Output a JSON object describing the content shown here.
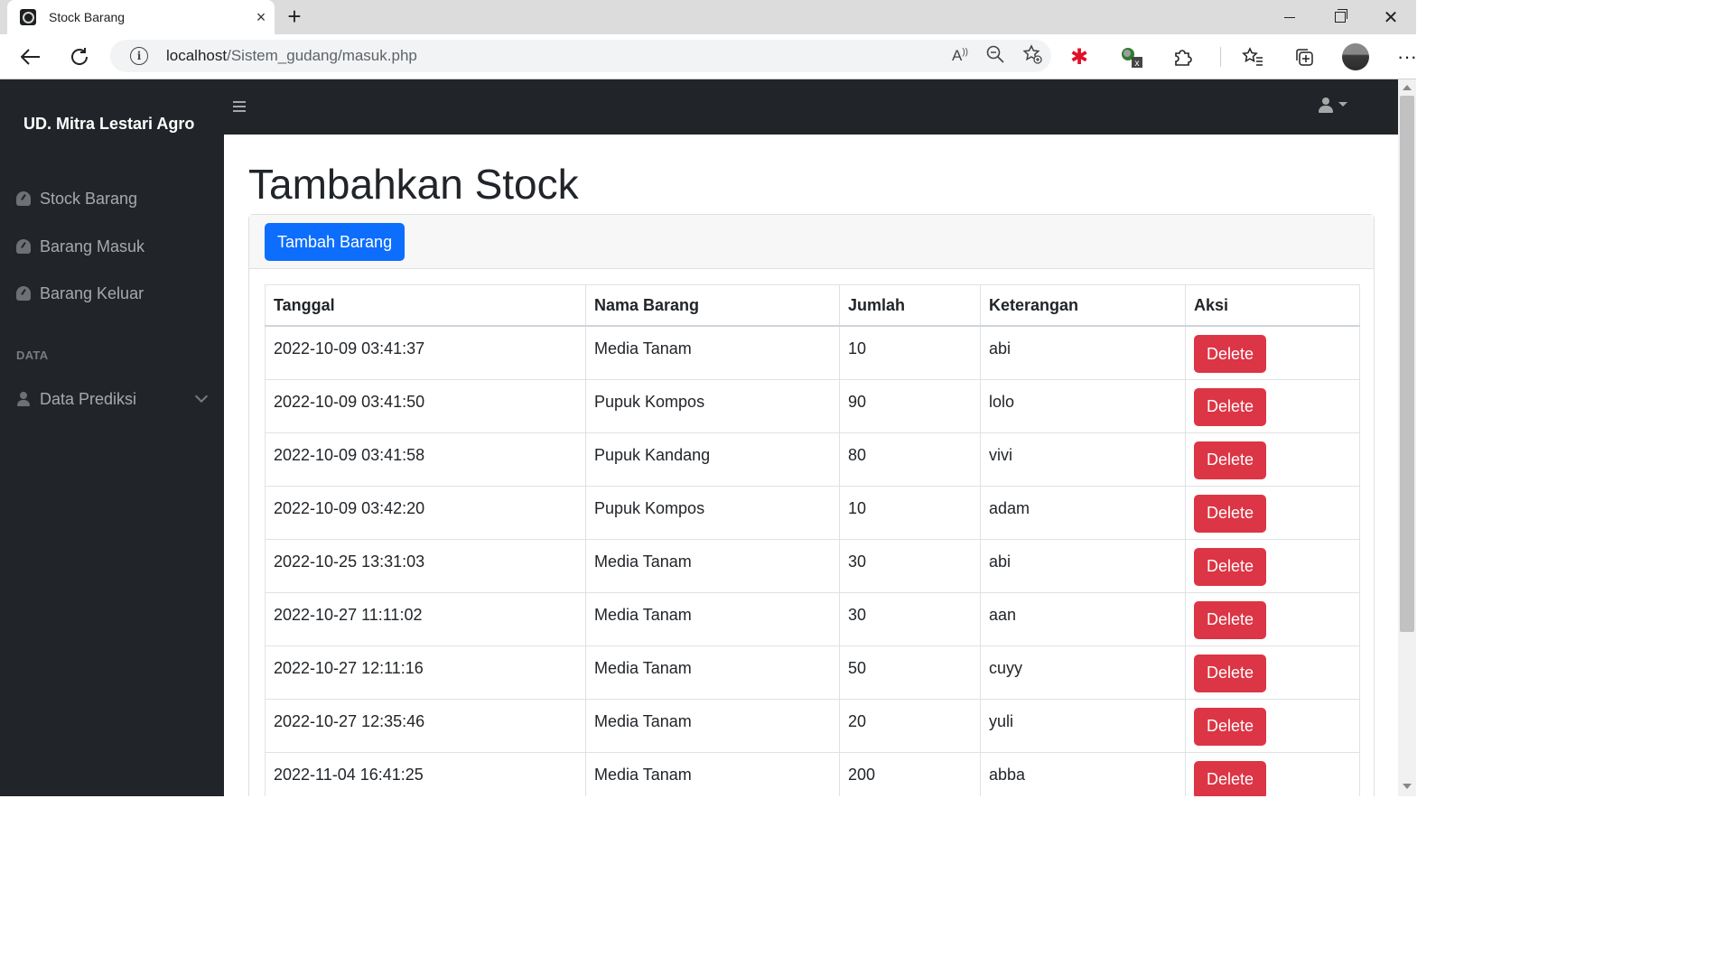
{
  "browser": {
    "tab_title": "Stock Barang",
    "url_host": "localhost",
    "url_path": "/Sistem_gudang/masuk.php"
  },
  "sidebar": {
    "brand": "UD. Mitra Lestari Agro",
    "items": [
      {
        "label": "Stock Barang",
        "icon": "gauge-icon"
      },
      {
        "label": "Barang Masuk",
        "icon": "gauge-icon"
      },
      {
        "label": "Barang Keluar",
        "icon": "gauge-icon"
      }
    ],
    "heading": "DATA",
    "dropdown": {
      "label": "Data Prediksi",
      "icon": "user-icon"
    }
  },
  "main": {
    "title": "Tambahkan Stock",
    "add_button": "Tambah Barang",
    "table": {
      "headers": [
        "Tanggal",
        "Nama Barang",
        "Jumlah",
        "Keterangan",
        "Aksi"
      ],
      "delete_label": "Delete",
      "rows": [
        [
          "2022-10-09 03:41:37",
          "Media Tanam",
          "10",
          "abi"
        ],
        [
          "2022-10-09 03:41:50",
          "Pupuk Kompos",
          "90",
          "lolo"
        ],
        [
          "2022-10-09 03:41:58",
          "Pupuk Kandang",
          "80",
          "vivi"
        ],
        [
          "2022-10-09 03:42:20",
          "Pupuk Kompos",
          "10",
          "adam"
        ],
        [
          "2022-10-25 13:31:03",
          "Media Tanam",
          "30",
          "abi"
        ],
        [
          "2022-10-27 11:11:02",
          "Media Tanam",
          "30",
          "aan"
        ],
        [
          "2022-10-27 12:11:16",
          "Media Tanam",
          "50",
          "cuyy"
        ],
        [
          "2022-10-27 12:35:46",
          "Media Tanam",
          "20",
          "yuli"
        ],
        [
          "2022-11-04 16:41:25",
          "Media Tanam",
          "200",
          "abba"
        ]
      ]
    }
  },
  "colors": {
    "sidebar_bg": "#212529",
    "primary": "#0d6efd",
    "danger": "#dc3545"
  }
}
